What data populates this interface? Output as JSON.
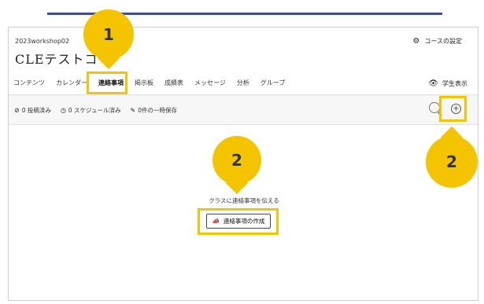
{
  "course": {
    "id": "2023workshop02",
    "title": "CLEテストコ"
  },
  "header": {
    "settings_label": "コースの設定",
    "student_view_label": "学生表示"
  },
  "tabs": [
    {
      "label": "コンテンツ"
    },
    {
      "label": "カレンダー"
    },
    {
      "label": "連絡事項"
    },
    {
      "label": "掲示板"
    },
    {
      "label": "成績表"
    },
    {
      "label": "メッセージ"
    },
    {
      "label": "分析"
    },
    {
      "label": "グループ"
    }
  ],
  "status": {
    "posted": "0 投稿済み",
    "scheduled": "0 スケジュール済み",
    "draft": "0件の一時保存"
  },
  "empty_state": {
    "message": "クラスに連絡事項を伝える",
    "create_button": "連絡事項の作成"
  },
  "markers": {
    "m1": "1",
    "m2a": "2",
    "m2b": "2"
  },
  "colors": {
    "highlight": "#f5c400",
    "top_rule": "#3f4a9a"
  },
  "icons": [
    "gear-icon",
    "eye-icon",
    "check-circle-icon",
    "clock-icon",
    "pencil-icon",
    "search-icon",
    "add-circle-icon",
    "megaphone-icon"
  ]
}
